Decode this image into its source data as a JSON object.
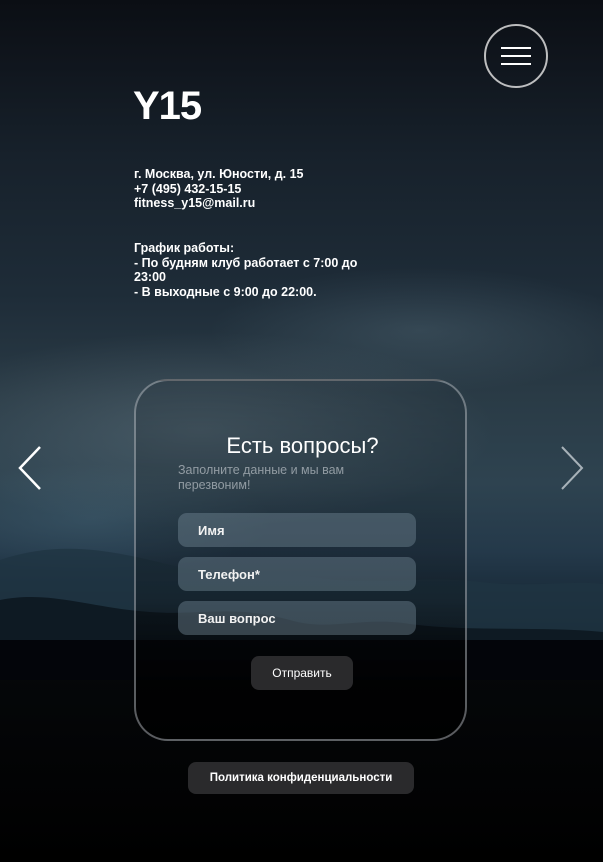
{
  "header": {
    "logo": "Y15",
    "menu_icon": "hamburger-menu-icon"
  },
  "contacts": {
    "address": "г. Москва, ул. Юности, д. 15",
    "phone": "+7 (495) 432-15-15",
    "email": "fitness_y15@mail.ru"
  },
  "schedule": {
    "title": "График работы:",
    "weekdays": "- По будням клуб работает с 7:00 до 23:00",
    "weekends": "- В выходные с 9:00 до 22:00."
  },
  "carousel": {
    "prev_icon": "chevron-left-icon",
    "next_icon": "chevron-right-icon"
  },
  "form": {
    "title": "Есть вопросы?",
    "subtitle": "Заполните данные и мы вам перезвоним!",
    "name_placeholder": "Имя",
    "phone_placeholder": "Телефон*",
    "question_placeholder": "Ваш вопрос",
    "submit_label": "Отправить"
  },
  "footer": {
    "policy_label": "Политика конфиденциальности"
  },
  "colors": {
    "button_bg": "#2a2a2c",
    "field_bg": "rgba(120,140,155,0.42)",
    "background_dark": "#000000"
  }
}
